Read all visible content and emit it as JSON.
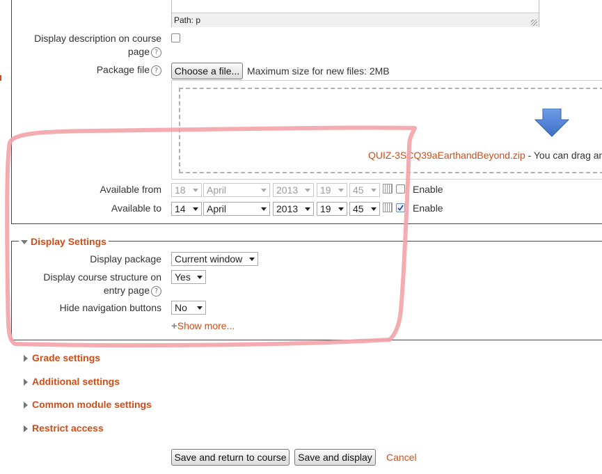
{
  "editor": {
    "path_label": "Path: p"
  },
  "display_description": {
    "label_line1": "Display description on course",
    "label_line2": "page",
    "checked": false
  },
  "package_file": {
    "label": "Package file",
    "choose_button": "Choose a file...",
    "max_size": "Maximum size for new files: 2MB",
    "file_name": "QUIZ-3SCQ39aEarthandBeyond.zip",
    "drag_text": " - You can drag and"
  },
  "available_from": {
    "label": "Available from",
    "day": "18",
    "month": "April",
    "year": "2013",
    "hour": "19",
    "minute": "45",
    "enable_label": "Enable",
    "enabled": false
  },
  "available_to": {
    "label": "Available to",
    "day": "14",
    "month": "April",
    "year": "2013",
    "hour": "19",
    "minute": "45",
    "enable_label": "Enable",
    "enabled": true
  },
  "display_settings": {
    "title": "Display Settings",
    "display_package_label": "Display package",
    "display_package_value": "Current window",
    "course_structure_label_line1": "Display course structure on",
    "course_structure_label_line2": "entry page",
    "course_structure_value": "Yes",
    "hide_nav_label": "Hide navigation buttons",
    "hide_nav_value": "No",
    "show_more": "Show more..."
  },
  "sections": [
    {
      "title": "Grade settings"
    },
    {
      "title": "Additional settings"
    },
    {
      "title": "Common module settings"
    },
    {
      "title": "Restrict access"
    }
  ],
  "actions": {
    "save_return": "Save and return to course",
    "save_display": "Save and display",
    "cancel": "Cancel"
  },
  "colors": {
    "accent": "#d14d16",
    "annotation": "#f4a3a8",
    "arrow": "#4a7fd4"
  }
}
